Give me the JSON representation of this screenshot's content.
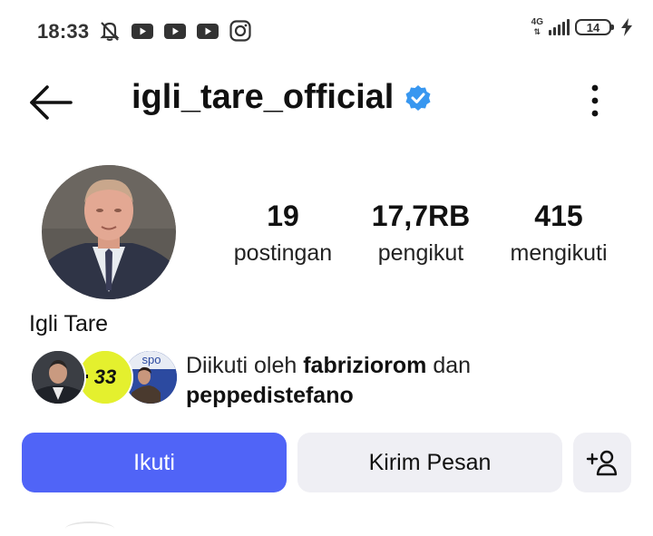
{
  "status_bar": {
    "time": "18:33",
    "network": "4G",
    "battery": "14",
    "icons": [
      "mute-icon",
      "youtube-icon",
      "youtube-icon",
      "youtube-icon",
      "instagram-icon",
      "signal-icon",
      "battery-icon",
      "charging-icon"
    ]
  },
  "header": {
    "username": "igli_tare_official",
    "verified": true,
    "back_icon": "arrow-left-icon",
    "menu_icon": "more-vertical-icon"
  },
  "profile": {
    "full_name": "Igli Tare",
    "stats": [
      {
        "value": "19",
        "label": "postingan"
      },
      {
        "value": "17,7RB",
        "label": "pengikut"
      },
      {
        "value": "415",
        "label": "mengikuti"
      }
    ]
  },
  "followed_by": {
    "prefix": "Diikuti oleh",
    "user1": "fabriziorom",
    "conjunction": "dan",
    "user2": "peppedistefano",
    "badge_text": "33",
    "badge_text2": "spo"
  },
  "actions": {
    "follow_label": "Ikuti",
    "message_label": "Kirim Pesan",
    "add_user_icon": "add-person-icon"
  },
  "colors": {
    "primary": "#5064f7",
    "secondary_bg": "#efeff4",
    "verified_blue": "#3897f0"
  }
}
